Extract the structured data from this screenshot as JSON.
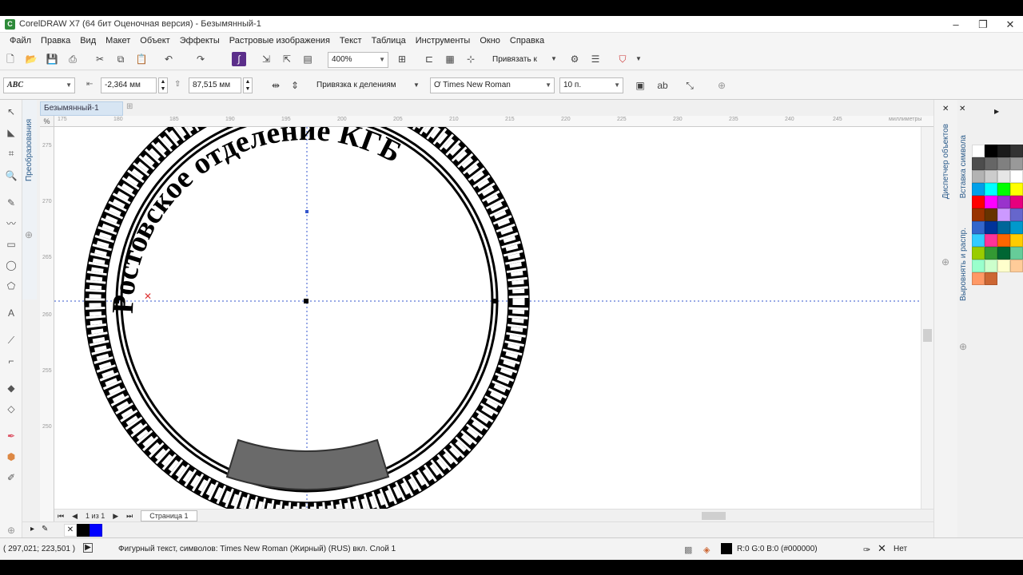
{
  "window": {
    "title": "CorelDRAW X7 (64 бит Оценочная версия) - Безымянный-1",
    "controls": [
      "–",
      "❐",
      "✕"
    ]
  },
  "menu": [
    "Файл",
    "Правка",
    "Вид",
    "Макет",
    "Объект",
    "Эффекты",
    "Растровые изображения",
    "Текст",
    "Таблица",
    "Инструменты",
    "Окно",
    "Справка"
  ],
  "toolbar": {
    "zoom": "400%",
    "snap": "Привязать к"
  },
  "propertybar": {
    "text_preset": "ABC",
    "offset_x": "-2,364 мм",
    "offset_y": "87,515 мм",
    "snap_marks": "Привязка к делениям",
    "font": "Times New Roman",
    "font_size": "10 п."
  },
  "document_tab": "Безымянный-1",
  "dockers": {
    "left": "Преобразования",
    "right_1": "Диспетчер объектов",
    "right_2": "Вставка символа",
    "right_3": "Выровнять и распр."
  },
  "ruler": {
    "units": "миллиметры",
    "h_labels": [
      "175",
      "180",
      "185",
      "190",
      "195",
      "200",
      "205",
      "210",
      "215",
      "220",
      "225",
      "230",
      "235",
      "240",
      "245"
    ],
    "v_labels": [
      "%",
      "275",
      "270",
      "265",
      "260",
      "255",
      "250"
    ]
  },
  "canvas_text": {
    "arc_text": "Ростовское отделение КГБ"
  },
  "page_nav": {
    "counter": "1 из 1",
    "page_tab": "Страница 1"
  },
  "status": {
    "coords": "( 297,021; 223,501 )",
    "info": "Фигурный текст, символов: Times New Roman (Жирный) (RUS) вкл. Слой 1",
    "fill_color": "R:0 G:0 B:0 (#000000)",
    "outline": "Нет"
  },
  "palette_colors": [
    "#ffffff",
    "#000000",
    "#1a1a1a",
    "#333333",
    "#4d4d4d",
    "#666666",
    "#808080",
    "#999999",
    "#b3b3b3",
    "#cccccc",
    "#e6e6e6",
    "#ffffff",
    "#00a0e9",
    "#00ffff",
    "#00ff00",
    "#ffff00",
    "#ff0000",
    "#ff00ff",
    "#9933cc",
    "#e6007e",
    "#993300",
    "#663300",
    "#cc99ff",
    "#6666cc",
    "#3366cc",
    "#003399",
    "#006699",
    "#0099cc",
    "#33ccff",
    "#ff3399",
    "#ff6600",
    "#ffcc00",
    "#99cc00",
    "#339933",
    "#006633",
    "#66cc99",
    "#99ffcc",
    "#ccffcc",
    "#ffffcc",
    "#ffcc99",
    "#ff9966",
    "#cc6633"
  ]
}
